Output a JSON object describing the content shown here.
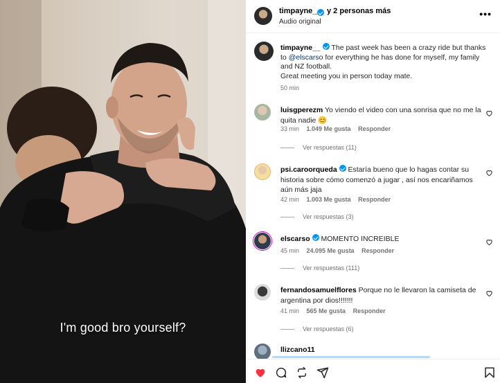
{
  "video": {
    "subtitle": "I'm good bro yourself?"
  },
  "header": {
    "username": "timpayne__",
    "collaborators": "y 2 personas más",
    "audio": "Audio original",
    "more": "•••"
  },
  "caption": {
    "username": "timpayne__",
    "text_part1": "The past week has been a crazy ride but thanks to",
    "mention": "@elscarso",
    "text_part2": "for everything he has done for myself, my family and NZ football.",
    "text_line2": "Great meeting you in person today mate.",
    "time": "50 min"
  },
  "comments": [
    {
      "username": "luisgperezm",
      "text": "Yo viendo el video con una sonrisa que no me la quita nadie 😊",
      "time": "33 min",
      "likes": "1.049 Me gusta",
      "reply": "Responder",
      "view_replies": "Ver respuestas (11)"
    },
    {
      "username": "psi.caroorqueda",
      "text": "Estaría bueno que lo hagas contar su historia sobre cómo comenzó a jugar , así nos encariñamos aún más jaja",
      "time": "42 min",
      "likes": "1.003 Me gusta",
      "reply": "Responder",
      "view_replies": "Ver respuestas (3)"
    },
    {
      "username": "elscarso",
      "text": "MOMENTO INCREIBLE",
      "time": "45 min",
      "likes": "24.095 Me gusta",
      "reply": "Responder",
      "view_replies": "Ver respuestas (111)"
    },
    {
      "username": "fernandosamuelflores",
      "text": "Porque no le llevaron la camiseta de argentina por dios!!!!!!!",
      "time": "41 min",
      "likes": "565 Me gusta",
      "reply": "Responder",
      "view_replies": "Ver respuestas (6)"
    },
    {
      "username": "llizcano11"
    }
  ],
  "footer": {
    "icons": [
      "heart-filled-icon",
      "comment-icon",
      "repost-icon",
      "share-icon",
      "bookmark-icon"
    ]
  },
  "colors": {
    "verified": "#0095f6",
    "like_red": "#ff3040",
    "mention": "#00376b"
  }
}
